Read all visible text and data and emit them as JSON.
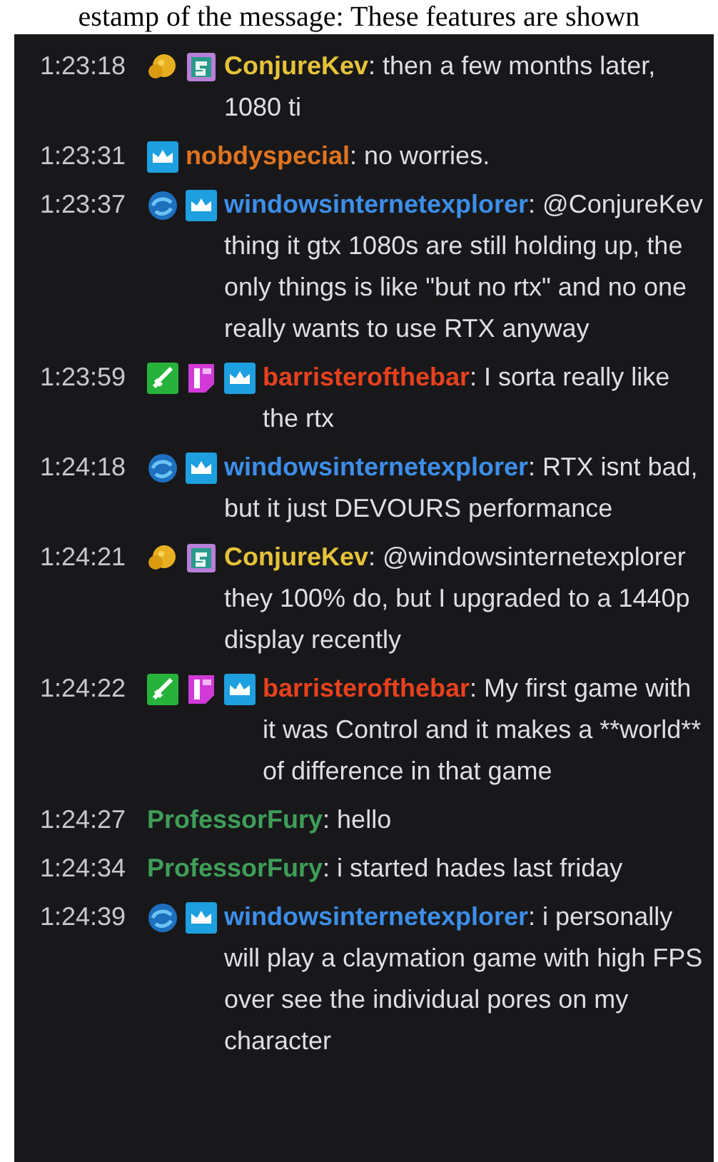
{
  "caption": "estamp of the message: These features are shown",
  "messages": [
    {
      "time": "1:23:18",
      "badges": [
        {
          "kind": "gem"
        },
        {
          "kind": "sub"
        }
      ],
      "user": "ConjureKev",
      "color": "#e6c23a",
      "text": ": then a few months later, 1080 ti"
    },
    {
      "time": "1:23:31",
      "badges": [
        {
          "kind": "crown"
        }
      ],
      "user": "nobdyspecial",
      "color": "#e0741f",
      "text": ": no worries."
    },
    {
      "time": "1:23:37",
      "badges": [
        {
          "kind": "wave"
        },
        {
          "kind": "crown"
        }
      ],
      "user": "windowsinternetexplorer",
      "color": "#3d8ee8",
      "text": ": @ConjureKev thing it gtx 1080s are still holding up, the only things is like \"but no rtx\" and no one really wants to use RTX anyway"
    },
    {
      "time": "1:23:59",
      "badges": [
        {
          "kind": "sword"
        },
        {
          "kind": "first"
        },
        {
          "kind": "crown"
        }
      ],
      "user": "barristerofthebar",
      "color": "#e8411d",
      "text": ": I sorta really like the rtx"
    },
    {
      "time": "1:24:18",
      "badges": [
        {
          "kind": "wave"
        },
        {
          "kind": "crown"
        }
      ],
      "user": "windowsinternetexplorer",
      "color": "#3d8ee8",
      "text": ": RTX isnt bad, but it just DEVOURS performance"
    },
    {
      "time": "1:24:21",
      "badges": [
        {
          "kind": "gem"
        },
        {
          "kind": "sub"
        }
      ],
      "user": "ConjureKev",
      "color": "#e6c23a",
      "text": ": @windowsinternetexplorer they 100% do, but I upgraded to a 1440p display recently"
    },
    {
      "time": "1:24:22",
      "badges": [
        {
          "kind": "sword"
        },
        {
          "kind": "first"
        },
        {
          "kind": "crown"
        }
      ],
      "user": "barristerofthebar",
      "color": "#e8411d",
      "text": ": My first game with it was Control and it makes a **world** of difference in that game"
    },
    {
      "time": "1:24:27",
      "user": "ProfessorFury",
      "color": "#3f9e58",
      "text": ": hello"
    },
    {
      "time": "1:24:34",
      "user": "ProfessorFury",
      "color": "#3f9e58",
      "text": ": i started hades last friday"
    },
    {
      "time": "1:24:39",
      "badges": [
        {
          "kind": "wave"
        },
        {
          "kind": "crown"
        }
      ],
      "user": "windowsinternetexplorer",
      "color": "#3d8ee8",
      "text": ": i personally will play a claymation game with high FPS over see the individual pores on my character"
    }
  ]
}
